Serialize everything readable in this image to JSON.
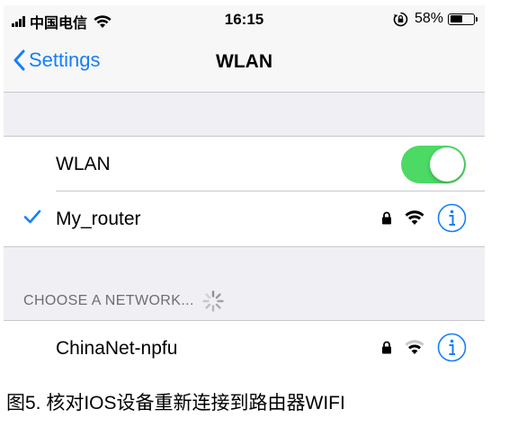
{
  "status_bar": {
    "carrier": "中国电信",
    "time": "16:15",
    "battery_percent": "58%",
    "battery_level": 0.58,
    "icons": [
      "signal-bars-icon",
      "wifi-icon",
      "orientation-lock-icon",
      "battery-icon"
    ]
  },
  "nav": {
    "back_label": "Settings",
    "title": "WLAN"
  },
  "wlan_toggle": {
    "label": "WLAN",
    "on": true
  },
  "connected_network": {
    "name": "My_router",
    "secured": true,
    "icons": [
      "checkmark-icon",
      "lock-icon",
      "wifi-icon",
      "info-icon"
    ]
  },
  "choose_section": {
    "header": "CHOOSE A NETWORK...",
    "icons": [
      "loading-spinner-icon"
    ]
  },
  "networks": [
    {
      "name": "ChinaNet-npfu",
      "secured": true,
      "icons": [
        "lock-icon",
        "wifi-icon",
        "info-icon"
      ]
    }
  ],
  "caption": "图5. 核对IOS设备重新连接到路由器WIFI",
  "colors": {
    "ios_blue": "#157efb",
    "toggle_green": "#4cd964",
    "group_bg": "#efeff4",
    "section_text": "#6d6d72"
  }
}
